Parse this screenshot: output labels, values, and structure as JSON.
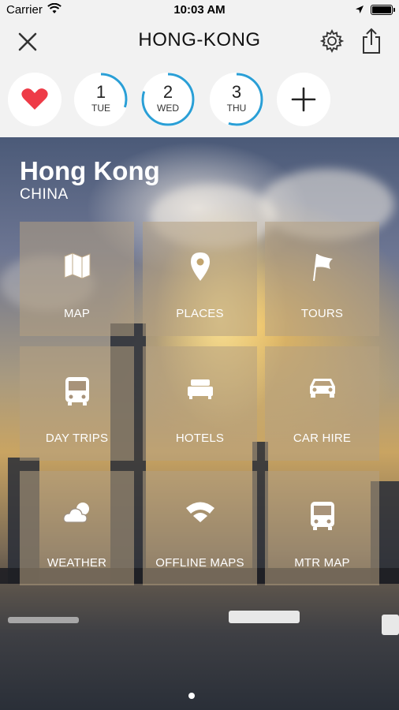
{
  "status_bar": {
    "carrier": "Carrier",
    "time": "10:03 AM"
  },
  "nav": {
    "title": "HONG-KONG",
    "close_icon": "close-icon",
    "settings_icon": "gear-icon",
    "share_icon": "share-icon"
  },
  "days": [
    {
      "num": "1",
      "dow": "TUE",
      "progress": 0.3
    },
    {
      "num": "2",
      "dow": "WED",
      "progress": 0.8
    },
    {
      "num": "3",
      "dow": "THU",
      "progress": 0.55
    }
  ],
  "favorite_icon": "heart-icon",
  "add_icon": "plus-icon",
  "destination": {
    "city": "Hong Kong",
    "country": "CHINA"
  },
  "tiles": [
    {
      "label": "MAP",
      "icon": "map-icon"
    },
    {
      "label": "PLACES",
      "icon": "pin-icon"
    },
    {
      "label": "TOURS",
      "icon": "flag-icon"
    },
    {
      "label": "DAY TRIPS",
      "icon": "bus-icon"
    },
    {
      "label": "HOTELS",
      "icon": "bed-icon"
    },
    {
      "label": "CAR HIRE",
      "icon": "car-icon"
    },
    {
      "label": "WEATHER",
      "icon": "weather-icon"
    },
    {
      "label": "OFFLINE MAPS",
      "icon": "wifi-icon"
    },
    {
      "label": "MTR MAP",
      "icon": "train-icon"
    }
  ],
  "colors": {
    "accent": "#2a9fd6",
    "heart": "#ee3b47"
  },
  "pager": {
    "pages": 1,
    "current": 1
  }
}
